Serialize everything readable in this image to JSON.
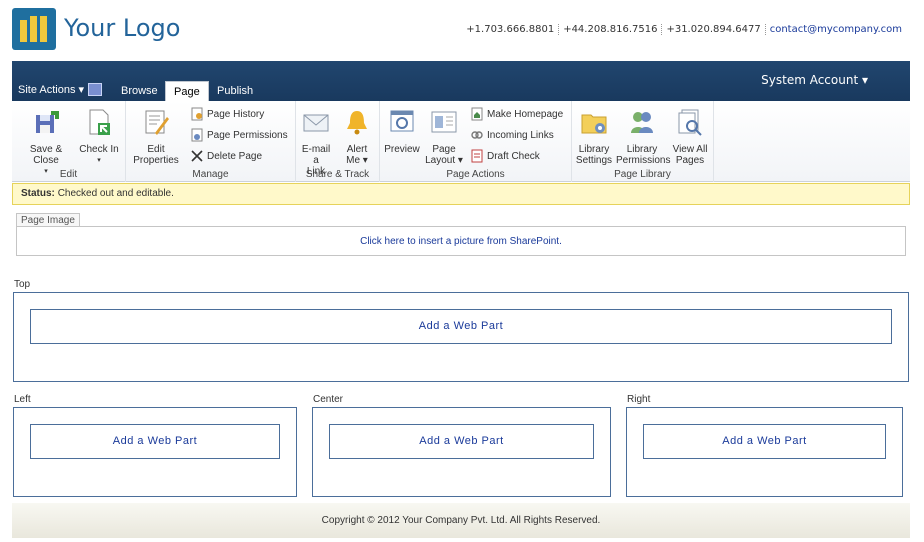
{
  "header": {
    "logo_text": "Your Logo",
    "contacts": [
      "+1.703.666.8801",
      "+44.208.816.7516",
      "+31.020.894.6477",
      "contact@mycompany.com"
    ]
  },
  "topbar": {
    "site_actions": "Site Actions ▾",
    "tabs": [
      "Browse",
      "Page",
      "Publish"
    ],
    "active_tab": "Page",
    "system_account": "System Account ▾"
  },
  "ribbon": {
    "edit": {
      "label": "Edit",
      "save_close": "Save & Close",
      "check_in": "Check In"
    },
    "manage": {
      "label": "Manage",
      "edit_properties": "Edit Properties",
      "page_history": "Page History",
      "page_permissions": "Page Permissions",
      "delete_page": "Delete Page"
    },
    "share": {
      "label": "Share & Track",
      "email_link_1": "E-mail a",
      "email_link_2": "Link",
      "alert_me_1": "Alert",
      "alert_me_2": "Me ▾"
    },
    "actions": {
      "label": "Page Actions",
      "preview": "Preview",
      "page_layout_1": "Page",
      "page_layout_2": "Layout ▾",
      "make_homepage": "Make Homepage",
      "incoming_links": "Incoming Links",
      "draft_check": "Draft Check"
    },
    "library": {
      "label": "Page Library",
      "settings_1": "Library",
      "settings_2": "Settings",
      "permissions_1": "Library",
      "permissions_2": "Permissions",
      "view_all_1": "View All",
      "view_all_2": "Pages"
    }
  },
  "status": {
    "label": "Status:",
    "text": "Checked out and editable."
  },
  "page_image": {
    "tab": "Page Image",
    "link": "Click here to insert a picture from SharePoint."
  },
  "zones": {
    "top": {
      "label": "Top",
      "button": "Add a Web Part"
    },
    "left": {
      "label": "Left",
      "button": "Add a Web Part"
    },
    "center": {
      "label": "Center",
      "button": "Add a Web Part"
    },
    "right": {
      "label": "Right",
      "button": "Add a Web Part"
    }
  },
  "footer": {
    "copyright": "Copyright © 2012 Your Company Pvt. Ltd. All Rights Reserved."
  },
  "colors": {
    "ribbon_bar": "#1f436b",
    "status_bg": "#fff9ca",
    "link": "#1a3a9a",
    "zone_border": "#4b6e9a"
  }
}
